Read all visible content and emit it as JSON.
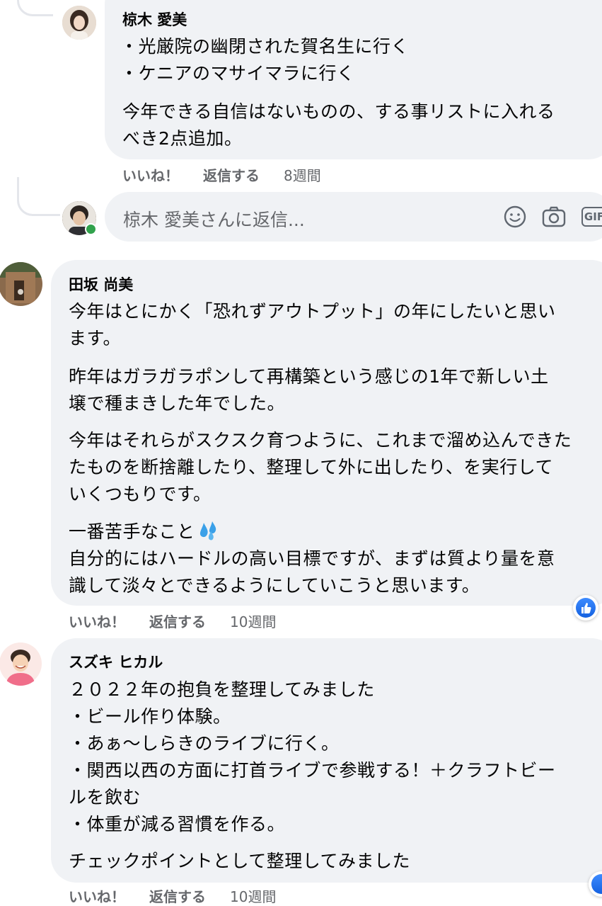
{
  "comment1": {
    "author": "椋木 愛美",
    "lines": [
      "・光厳院の幽閉された賀名生に行く",
      "・ケニアのマサイマラに行く",
      "今年できる自信はないものの、する事リストに入れる",
      "べき2点追加。"
    ],
    "actions": {
      "like": "いいね！",
      "reply": "返信する",
      "time": "8週間"
    }
  },
  "reply_box": {
    "placeholder": "椋木 愛美さんに返信...",
    "gif_label": "GIF"
  },
  "comment2": {
    "author": "田坂 尚美",
    "lines": [
      "今年はとにかく「恐れずアウトプット」の年にしたいと思い",
      "ます。",
      "昨年はガラガラポンして再構築という感じの1年で新しい土",
      "壌で種まきした年でした。",
      "今年はそれらがスクスク育つように、これまで溜め込んできた",
      "たものを断捨離したり、整理して外に出したり、を実行して",
      "いくつもりです。",
      "一番苦手なこと",
      "自分的にはハードルの高い目標ですが、まずは質より量を意",
      "識して淡々とできるようにしていこうと思います。"
    ],
    "actions": {
      "like": "いいね！",
      "reply": "返信する",
      "time": "10週間"
    }
  },
  "comment3": {
    "author": "スズキ ヒカル",
    "lines": [
      "２０２２年の抱負を整理してみました",
      "・ビール作り体験。",
      "・あぁ〜しらきのライブに行く。",
      "・関西以西の方面に打首ライブで参戦する！＋クラフトビー",
      "ルを飲む",
      "・体重が減る習慣を作る。",
      "チェックポイントとして整理してみました"
    ],
    "actions": {
      "like": "いいね！",
      "reply": "返信する",
      "time": "10週間"
    }
  },
  "colors": {
    "bubble": "#f0f2f5",
    "muted_text": "#65676b",
    "like_blue": "#1877f2",
    "online_green": "#31a24c"
  }
}
